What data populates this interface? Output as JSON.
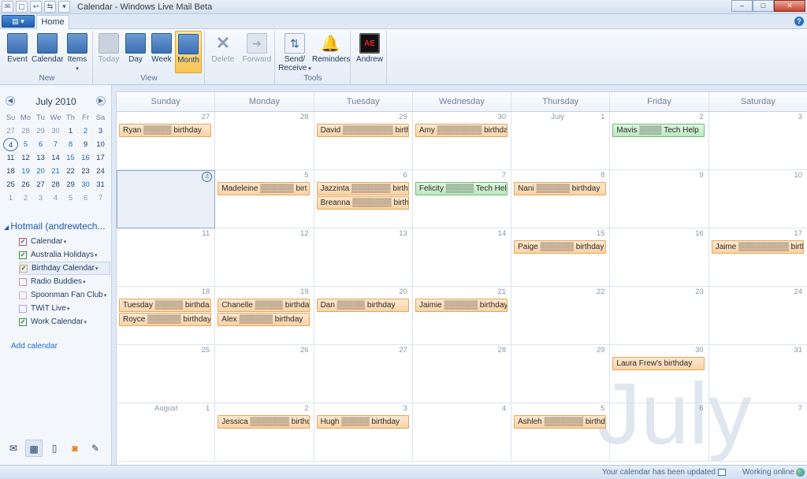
{
  "window": {
    "title": "Calendar - Windows Live Mail Beta",
    "buttons": {
      "minimize": "–",
      "maximize": "□",
      "close": "✕"
    }
  },
  "tabs": {
    "app_menu": "▤ ▾",
    "home": "Home",
    "help": "?"
  },
  "ribbon": {
    "new_group": "New",
    "view_group": "View",
    "tools_group": "Tools",
    "buttons": {
      "event": "Event",
      "calendar": "Calendar",
      "items": "Items",
      "today": "Today",
      "day": "Day",
      "week": "Week",
      "month": "Month",
      "delete": "Delete",
      "forward": "Forward",
      "send_receive": "Send/ Receive",
      "reminders": "Reminders",
      "user": "Andrew"
    }
  },
  "mini_calendar": {
    "title": "July 2010",
    "weekdays": [
      "Su",
      "Mo",
      "Tu",
      "We",
      "Th",
      "Fr",
      "Sa"
    ],
    "weeks": [
      [
        "27",
        "28",
        "29",
        "30",
        "1",
        "2",
        "3"
      ],
      [
        "4",
        "5",
        "6",
        "7",
        "8",
        "9",
        "10"
      ],
      [
        "11",
        "12",
        "13",
        "14",
        "15",
        "16",
        "17"
      ],
      [
        "18",
        "19",
        "20",
        "21",
        "22",
        "23",
        "24"
      ],
      [
        "25",
        "26",
        "27",
        "28",
        "29",
        "30",
        "31"
      ],
      [
        "1",
        "2",
        "3",
        "4",
        "5",
        "6",
        "7"
      ]
    ]
  },
  "account": {
    "name": "Hotmail (andrewtech...",
    "calendars": [
      {
        "label": "Calendar",
        "color": "#c04a7a"
      },
      {
        "label": "Australia Holidays",
        "color": "#3a8f3a"
      },
      {
        "label": "Birthday Calendar",
        "color": "#e3a85c"
      },
      {
        "label": "Radio Buddies",
        "color": "#d98fa0"
      },
      {
        "label": "Spoonman Fan Club",
        "color": "#e2a6c4"
      },
      {
        "label": "TWiT Live",
        "color": "#b79fd8"
      },
      {
        "label": "Work Calendar",
        "color": "#3a8f3a"
      }
    ],
    "add_calendar": "Add calendar"
  },
  "month_view": {
    "weekdays": [
      "Sunday",
      "Monday",
      "Tuesday",
      "Wednesday",
      "Thursday",
      "Friday",
      "Saturday"
    ],
    "weeks": [
      {
        "days": [
          "27",
          "28",
          "29",
          "30",
          "1",
          "2",
          "3"
        ],
        "labels": [
          "",
          "",
          "",
          "",
          "July",
          "",
          ""
        ]
      },
      {
        "days": [
          "4",
          "5",
          "6",
          "7",
          "8",
          "9",
          "10"
        ],
        "labels": [
          "",
          "",
          "",
          "",
          "",
          "",
          ""
        ]
      },
      {
        "days": [
          "11",
          "12",
          "13",
          "14",
          "15",
          "16",
          "17"
        ],
        "labels": [
          "",
          "",
          "",
          "",
          "",
          "",
          ""
        ]
      },
      {
        "days": [
          "18",
          "19",
          "20",
          "21",
          "22",
          "23",
          "24"
        ],
        "labels": [
          "",
          "",
          "",
          "",
          "",
          "",
          ""
        ]
      },
      {
        "days": [
          "25",
          "26",
          "27",
          "28",
          "29",
          "30",
          "31"
        ],
        "labels": [
          "",
          "",
          "",
          "",
          "",
          "",
          ""
        ]
      },
      {
        "days": [
          "1",
          "2",
          "3",
          "4",
          "5",
          "6",
          "7"
        ],
        "labels": [
          "August",
          "",
          "",
          "",
          "",
          "",
          ""
        ]
      }
    ],
    "events": [
      {
        "week": 0,
        "day": 0,
        "slot": 0,
        "text": "Ryan ▒▒▒▒▒ birthday",
        "kind": "birthday"
      },
      {
        "week": 0,
        "day": 2,
        "slot": 0,
        "text": "David ▒▒▒▒▒▒▒▒▒ birthd",
        "kind": "birthday"
      },
      {
        "week": 0,
        "day": 3,
        "slot": 0,
        "text": "Amy ▒▒▒▒▒▒▒▒ birthday",
        "kind": "birthday"
      },
      {
        "week": 0,
        "day": 5,
        "slot": 0,
        "text": "Mavis ▒▒▒▒ Tech Help",
        "kind": "work"
      },
      {
        "week": 1,
        "day": 1,
        "slot": 0,
        "text": "Madeleine ▒▒▒▒▒▒ birt",
        "kind": "birthday"
      },
      {
        "week": 1,
        "day": 2,
        "slot": 0,
        "text": "Jazzinta ▒▒▒▒▒▒▒ birth",
        "kind": "birthday"
      },
      {
        "week": 1,
        "day": 2,
        "slot": 1,
        "text": "Breanna ▒▒▒▒▒▒▒ birth",
        "kind": "birthday"
      },
      {
        "week": 1,
        "day": 3,
        "slot": 0,
        "text": "Felicity ▒▒▒▒▒ Tech Help",
        "kind": "work"
      },
      {
        "week": 1,
        "day": 4,
        "slot": 0,
        "text": "Nani ▒▒▒▒▒▒ birthday",
        "kind": "birthday"
      },
      {
        "week": 2,
        "day": 4,
        "slot": 0,
        "text": "Paige ▒▒▒▒▒▒ birthday",
        "kind": "birthday"
      },
      {
        "week": 2,
        "day": 6,
        "slot": 0,
        "text": "Jaime ▒▒▒▒▒▒▒▒▒ birth",
        "kind": "birthday"
      },
      {
        "week": 3,
        "day": 0,
        "slot": 0,
        "text": "Tuesday ▒▒▒▒▒ birthda",
        "kind": "birthday"
      },
      {
        "week": 3,
        "day": 0,
        "slot": 1,
        "text": "Royce ▒▒▒▒▒▒ birthday",
        "kind": "birthday"
      },
      {
        "week": 3,
        "day": 1,
        "slot": 0,
        "text": "Chanelle ▒▒▒▒▒ birthda",
        "kind": "birthday"
      },
      {
        "week": 3,
        "day": 1,
        "slot": 1,
        "text": "Alex ▒▒▒▒▒▒ birthday",
        "kind": "birthday"
      },
      {
        "week": 3,
        "day": 2,
        "slot": 0,
        "text": "Dan ▒▒▒▒▒ birthday",
        "kind": "birthday"
      },
      {
        "week": 3,
        "day": 3,
        "slot": 0,
        "text": "Jaimie ▒▒▒▒▒▒ birthday",
        "kind": "birthday"
      },
      {
        "week": 4,
        "day": 5,
        "slot": 0,
        "text": "Laura Frew's birthday",
        "kind": "birthday"
      },
      {
        "week": 5,
        "day": 1,
        "slot": 0,
        "text": "Jessica ▒▒▒▒▒▒▒ birthda",
        "kind": "birthday"
      },
      {
        "week": 5,
        "day": 2,
        "slot": 0,
        "text": "Hugh ▒▒▒▒▒ birthday",
        "kind": "birthday"
      },
      {
        "week": 5,
        "day": 4,
        "slot": 0,
        "text": "Ashleh ▒▒▒▒▒▒▒ birthda",
        "kind": "birthday"
      }
    ],
    "watermark": "July"
  },
  "status": {
    "message": "Your calendar has been updated",
    "connection": "Working online"
  }
}
